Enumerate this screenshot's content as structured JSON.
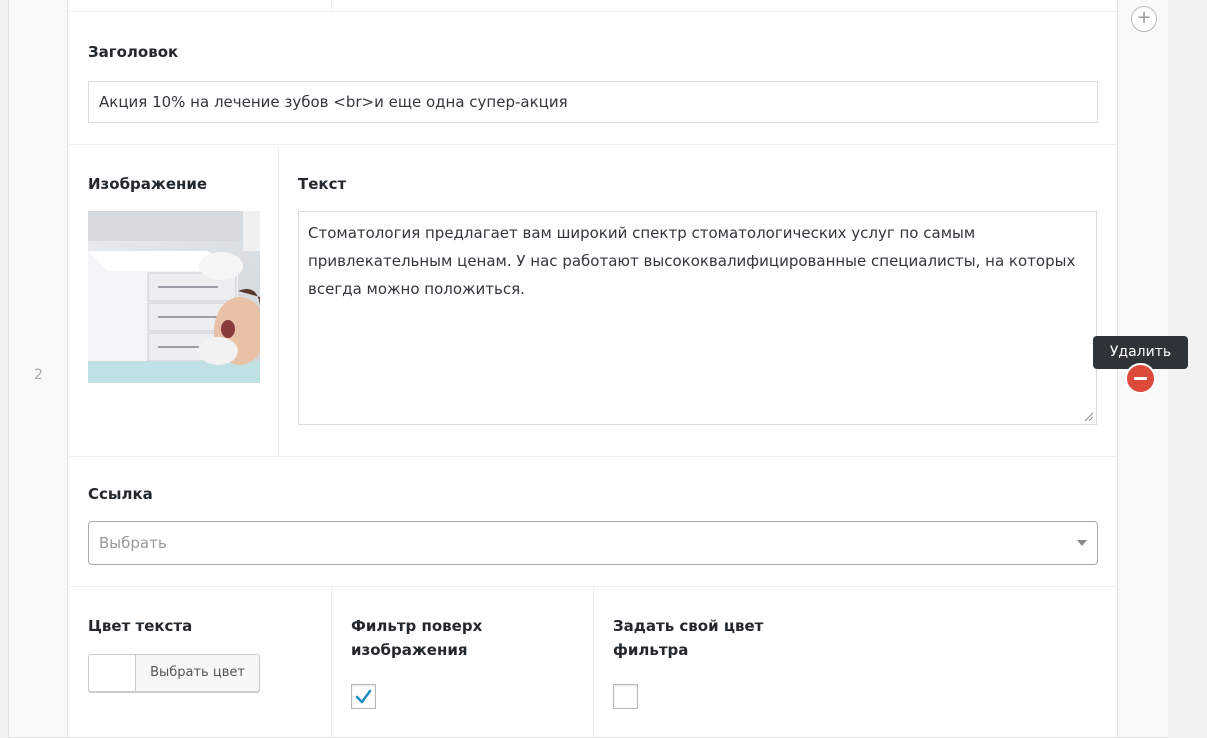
{
  "row": {
    "index": "2"
  },
  "fields": {
    "title": {
      "label": "Заголовок",
      "value": "Акция 10% на лечение зубов <br>и еще одна супер-акция"
    },
    "image": {
      "label": "Изображение",
      "alt": "dentist-patient-photo"
    },
    "text": {
      "label": "Текст",
      "value": "Стоматология предлагает вам широкий спектр стоматологических услуг по самым привлекательным ценам. У нас работают высококвалифицированные специалисты, на которых всегда можно положиться."
    },
    "link": {
      "label": "Ссылка",
      "placeholder": "Выбрать"
    },
    "text_color": {
      "label": "Цвет текста",
      "button_label": "Выбрать цвет",
      "swatch_color": "#ffffff"
    },
    "image_filter": {
      "label": "Фильтр поверх изображения",
      "checked": true
    },
    "custom_filter_color": {
      "label": "Задать свой цвет фильтра",
      "checked": false
    }
  },
  "actions": {
    "add_icon": "plus-circle-icon",
    "remove_icon": "minus-circle-icon",
    "remove_tooltip": "Удалить",
    "remove_color": "#dd4a3a"
  }
}
